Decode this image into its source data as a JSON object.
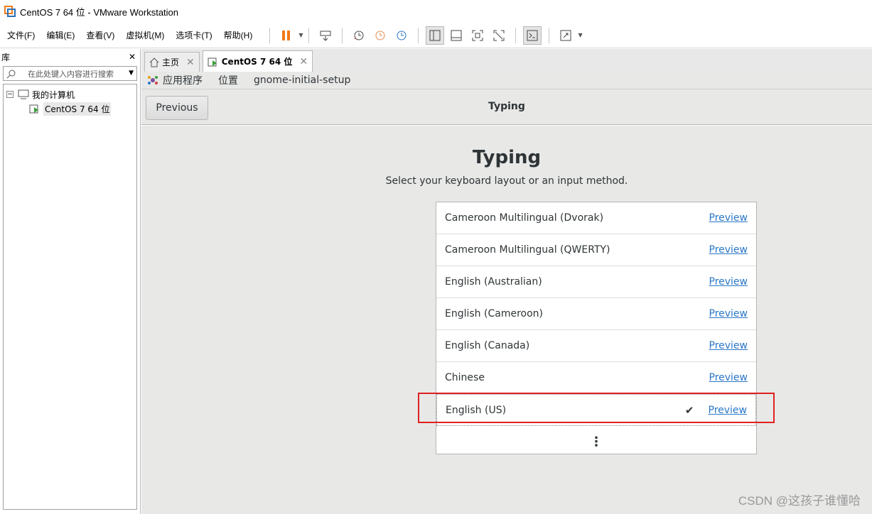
{
  "window": {
    "title": "CentOS 7 64 位 - VMware Workstation"
  },
  "menu": [
    "文件(F)",
    "编辑(E)",
    "查看(V)",
    "虚拟机(M)",
    "选项卡(T)",
    "帮助(H)"
  ],
  "library": {
    "title": "库",
    "search_placeholder": "在此处键入内容进行搜索",
    "root": "我的计算机",
    "vm": "CentOS 7 64 位"
  },
  "tabs": [
    {
      "label": "主页"
    },
    {
      "label": "CentOS 7 64 位"
    }
  ],
  "gnome_bar": {
    "apps": "应用程序",
    "places": "位置",
    "window": "gnome-initial-setup"
  },
  "header": {
    "previous_label": "Previous",
    "title": "Typing"
  },
  "page": {
    "title": "Typing",
    "subtitle": "Select your keyboard layout or an input method."
  },
  "layouts": [
    {
      "name": "Cameroon Multilingual (Dvorak)",
      "preview": "Preview"
    },
    {
      "name": "Cameroon Multilingual (QWERTY)",
      "preview": "Preview"
    },
    {
      "name": "English (Australian)",
      "preview": "Preview"
    },
    {
      "name": "English (Cameroon)",
      "preview": "Preview"
    },
    {
      "name": "English (Canada)",
      "preview": "Preview"
    },
    {
      "name": "Chinese",
      "preview": "Preview"
    },
    {
      "name": "English (US)",
      "preview": "Preview",
      "check": "✔"
    }
  ],
  "more_label": "⋮",
  "watermark": "CSDN @这孩子谁懂哈",
  "colors": {
    "accent_link": "#2a76c6",
    "highlight": "#e02020",
    "pause_icon": "#f07a1a"
  }
}
